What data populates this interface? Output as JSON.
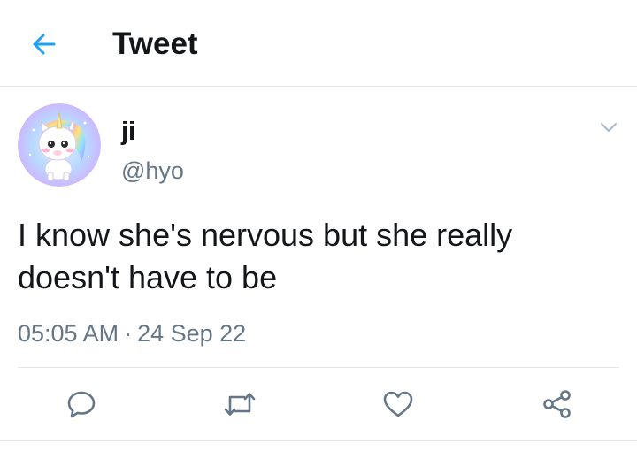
{
  "header": {
    "title": "Tweet",
    "back_icon": "back-arrow-icon",
    "accent_color": "#1da1f2"
  },
  "tweet": {
    "display_name": "ji",
    "handle": "@hyo",
    "text": "I know she's nervous but she really doesn't have to be",
    "time": "05:05 AM",
    "separator": "·",
    "date": "24 Sep 22",
    "avatar_icon": "unicorn-avatar",
    "caret_icon": "chevron-down-icon"
  },
  "actions": [
    {
      "icon": "reply-icon"
    },
    {
      "icon": "retweet-icon"
    },
    {
      "icon": "like-icon"
    },
    {
      "icon": "share-icon"
    }
  ],
  "colors": {
    "text": "#14171a",
    "secondary": "#657786",
    "icon": "#657786",
    "divider": "#e1e8ed"
  }
}
